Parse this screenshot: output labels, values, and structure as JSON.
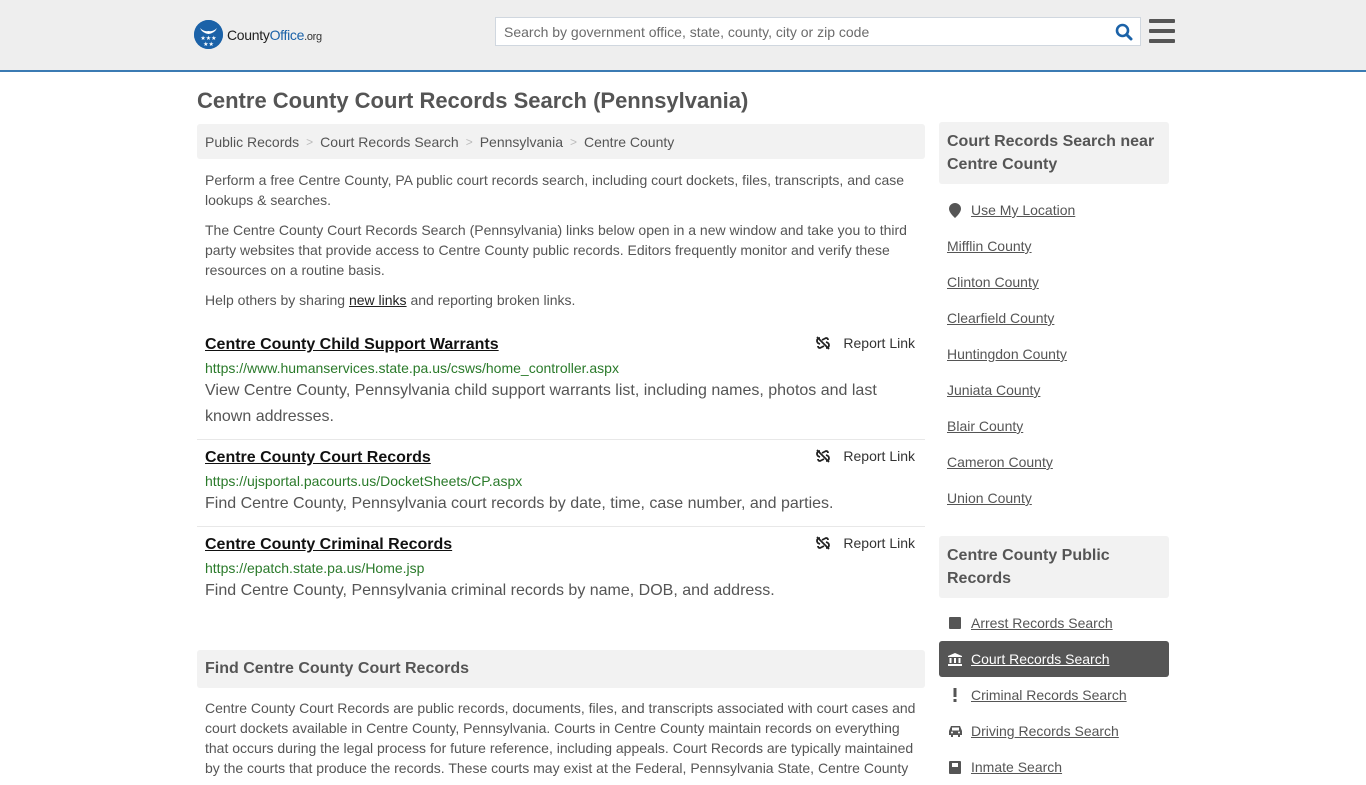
{
  "header": {
    "logo": {
      "part1": "County",
      "part2": "Office",
      "part3": ".org"
    },
    "search": {
      "placeholder": "Search by government office, state, county, city or zip code",
      "value": ""
    },
    "search_icon": "search-icon",
    "menu_icon": "hamburger-menu-icon"
  },
  "page": {
    "title": "Centre County Court Records Search (Pennsylvania)"
  },
  "breadcrumb": [
    {
      "label": "Public Records"
    },
    {
      "label": "Court Records Search"
    },
    {
      "label": "Pennsylvania"
    },
    {
      "label": "Centre County"
    }
  ],
  "intro": {
    "p1": "Perform a free Centre County, PA public court records search, including court dockets, files, transcripts, and case lookups & searches.",
    "p2": "The Centre County Court Records Search (Pennsylvania) links below open in a new window and take you to third party websites that provide access to Centre County public records. Editors frequently monitor and verify these resources on a routine basis.",
    "p3_before": "Help others by sharing ",
    "p3_link": "new links",
    "p3_after": " and reporting broken links."
  },
  "results": [
    {
      "title": "Centre County Child Support Warrants",
      "url": "https://www.humanservices.state.pa.us/csws/home_controller.aspx",
      "description": "View Centre County, Pennsylvania child support warrants list, including names, photos and last known addresses.",
      "report_label": "Report Link"
    },
    {
      "title": "Centre County Court Records",
      "url": "https://ujsportal.pacourts.us/DocketSheets/CP.aspx",
      "description": "Find Centre County, Pennsylvania court records by date, time, case number, and parties.",
      "report_label": "Report Link"
    },
    {
      "title": "Centre County Criminal Records",
      "url": "https://epatch.state.pa.us/Home.jsp",
      "description": "Find Centre County, Pennsylvania criminal records by name, DOB, and address.",
      "report_label": "Report Link"
    }
  ],
  "find_section": {
    "heading": "Find Centre County Court Records",
    "body": "Centre County Court Records are public records, documents, files, and transcripts associated with court cases and court dockets available in Centre County, Pennsylvania. Courts in Centre County maintain records on everything that occurs during the legal process for future reference, including appeals. Court Records are typically maintained by the courts that produce the records. These courts may exist at the Federal, Pennsylvania State, Centre County"
  },
  "sidebar": {
    "nearby": {
      "heading": "Court Records Search near Centre County",
      "use_location": "Use My Location",
      "counties": [
        "Mifflin County",
        "Clinton County",
        "Clearfield County",
        "Huntingdon County",
        "Juniata County",
        "Blair County",
        "Cameron County",
        "Union County"
      ]
    },
    "public_records": {
      "heading": "Centre County Public Records",
      "items": [
        {
          "label": "Arrest Records Search",
          "icon": "square-icon",
          "active": false
        },
        {
          "label": "Court Records Search",
          "icon": "courthouse-icon",
          "active": true
        },
        {
          "label": "Criminal Records Search",
          "icon": "exclamation-icon",
          "active": false
        },
        {
          "label": "Driving Records Search",
          "icon": "car-icon",
          "active": false
        },
        {
          "label": "Inmate Search",
          "icon": "inmate-icon",
          "active": false
        }
      ]
    }
  },
  "colors": {
    "brand_blue": "#1b62a8",
    "header_border": "#3b7bb3",
    "url_green": "#2a7a2a",
    "active_bg": "#555555"
  }
}
